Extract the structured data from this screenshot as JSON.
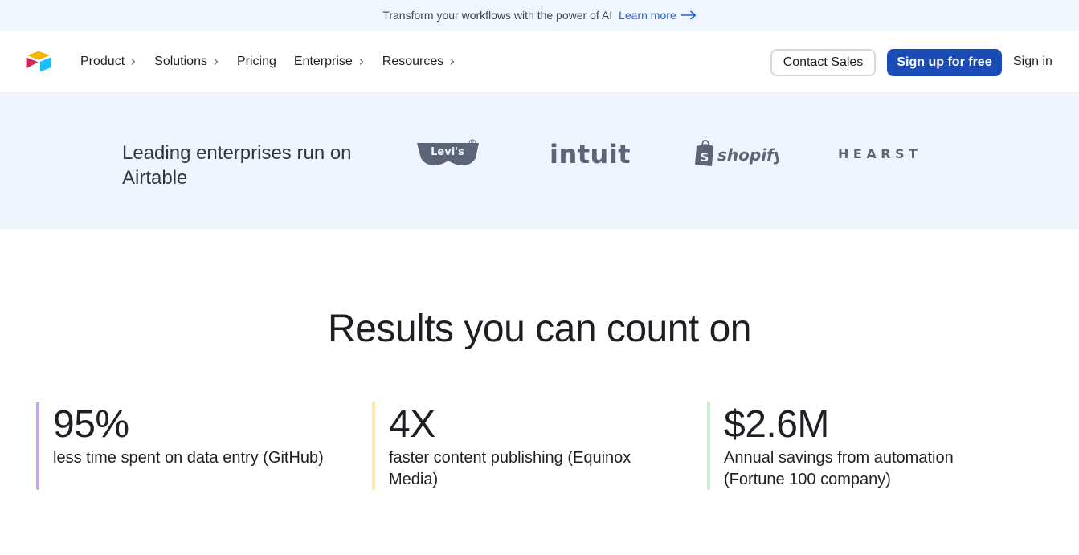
{
  "announcement": {
    "text": "Transform your workflows with the power of AI",
    "link_label": "Learn more"
  },
  "header": {
    "nav": [
      {
        "label": "Product",
        "has_chevron": true
      },
      {
        "label": "Solutions",
        "has_chevron": true
      },
      {
        "label": "Pricing",
        "has_chevron": false
      },
      {
        "label": "Enterprise",
        "has_chevron": true
      },
      {
        "label": "Resources",
        "has_chevron": true
      }
    ],
    "contact_label": "Contact Sales",
    "signup_label": "Sign up for free",
    "signin_label": "Sign in"
  },
  "band": {
    "text": "Leading enterprises run on Airtable",
    "logos": [
      "Levi's",
      "intuit",
      "shopify",
      "HEARST"
    ]
  },
  "results": {
    "title": "Results you can count on",
    "stats": [
      {
        "value": "95%",
        "desc": "less time spent on data entry (GitHub)",
        "color": "#c4a8f0"
      },
      {
        "value": "4X",
        "desc": "faster content publishing (Equinox Media)",
        "color": "#fbe8a6"
      },
      {
        "value": "$2.6M",
        "desc": "Annual savings from automation (Fortune 100 company)",
        "color": "#cdebd3"
      }
    ]
  },
  "colors": {
    "accent": "#1b4bb5",
    "link": "#1f63d8",
    "band_bg": "#eef5fe",
    "announce_bg": "#f0f6ff",
    "logo_gray": "#5c6477"
  },
  "icons": {
    "brand": "airtable-logo-icon",
    "nav_chevron": "chevron-right-icon",
    "learn_arrow": "arrow-right-icon"
  }
}
